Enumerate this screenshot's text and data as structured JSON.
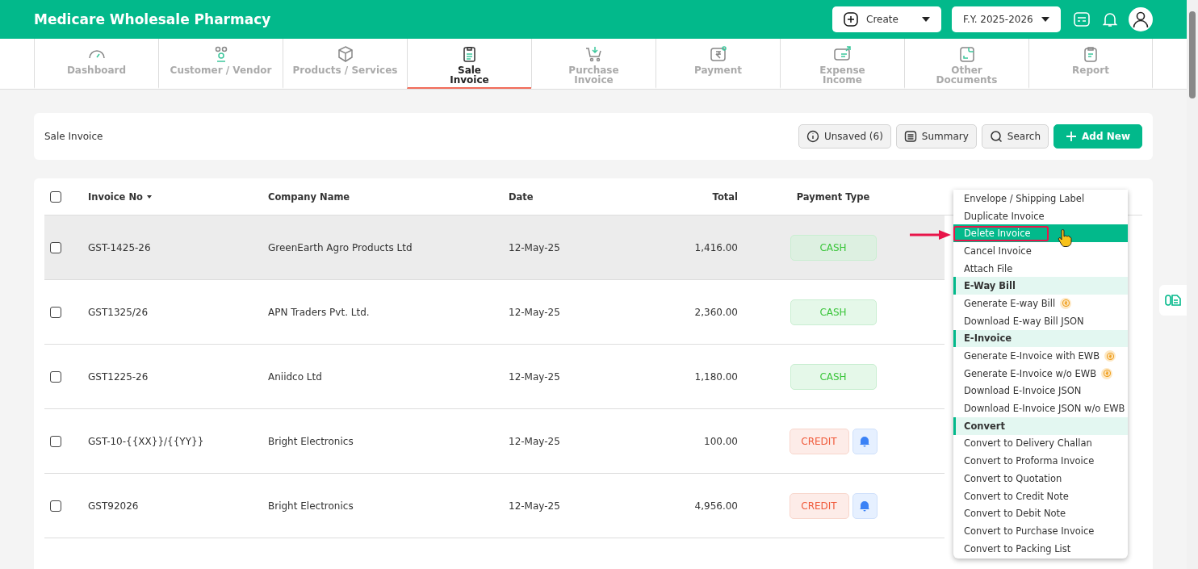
{
  "header": {
    "title": "Medicare Wholesale Pharmacy",
    "create_button": "Create",
    "year_select": "F.Y. 2025-2026"
  },
  "nav_tabs": [
    {
      "label": "Dashboard",
      "selected": false
    },
    {
      "label": "Customer / Vendor",
      "selected": false
    },
    {
      "label": "Products / Services",
      "selected": false
    },
    {
      "label": "Sale\nInvoice",
      "selected": true
    },
    {
      "label": "Purchase\nInvoice",
      "selected": false
    },
    {
      "label": "Payment",
      "selected": false
    },
    {
      "label": "Expense\nIncome",
      "selected": false
    },
    {
      "label": "Other\nDocuments",
      "selected": false
    },
    {
      "label": "Report",
      "selected": false
    }
  ],
  "toolbar": {
    "title": "Sale Invoice",
    "buttons": [
      {
        "label": "Unsaved (6)",
        "kind": "info"
      },
      {
        "label": "Summary",
        "kind": "list"
      },
      {
        "label": "Search",
        "kind": "search"
      },
      {
        "label": "Add New",
        "kind": "add"
      }
    ]
  },
  "table": {
    "select_all": {
      "checked": false
    },
    "columns": [
      "Invoice No",
      "Company Name",
      "Date",
      "Total",
      "Payment Type"
    ],
    "rows": [
      {
        "invoice_no": "GST-1425-26",
        "company": "GreenEarth Agro Products Ltd",
        "date": "12-May-25",
        "total": "1,416.00",
        "payment": "CASH",
        "kind": "cash",
        "checked": false,
        "highlighted": true
      },
      {
        "invoice_no": "GST1325/26",
        "company": "APN Traders Pvt. Ltd.",
        "date": "12-May-25",
        "total": "2,360.00",
        "payment": "CASH",
        "kind": "cash",
        "checked": false,
        "highlighted": false
      },
      {
        "invoice_no": "GST1225-26",
        "company": "Aniidco Ltd",
        "date": "12-May-25",
        "total": "1,180.00",
        "payment": "CASH",
        "kind": "cash",
        "checked": false,
        "highlighted": false
      },
      {
        "invoice_no": "GST-10-{{XX}}/{{YY}}",
        "company": "Bright Electronics",
        "date": "12-May-25",
        "total": "100.00",
        "payment": "CREDIT",
        "kind": "credit",
        "checked": false,
        "highlighted": false
      },
      {
        "invoice_no": "GST92026",
        "company": "Bright Electronics",
        "date": "12-May-25",
        "total": "4,956.00",
        "payment": "CREDIT",
        "kind": "credit",
        "checked": false,
        "highlighted": false
      }
    ]
  },
  "context_menu": [
    {
      "label": "Envelope / Shipping Label",
      "kind": "item",
      "selected": false
    },
    {
      "label": "Duplicate Invoice",
      "kind": "item",
      "selected": false
    },
    {
      "label": "Delete Invoice",
      "kind": "item",
      "selected": true
    },
    {
      "label": "Cancel Invoice",
      "kind": "item",
      "selected": false
    },
    {
      "label": "Attach File",
      "kind": "item",
      "selected": false
    },
    {
      "label": "E-Way Bill",
      "kind": "section"
    },
    {
      "label": "Generate E-way Bill",
      "kind": "premium",
      "selected": false
    },
    {
      "label": "Download E-way Bill JSON",
      "kind": "item",
      "selected": false
    },
    {
      "label": "E-Invoice",
      "kind": "section"
    },
    {
      "label": "Generate E-Invoice with EWB",
      "kind": "premium",
      "selected": false
    },
    {
      "label": "Generate E-Invoice w/o EWB",
      "kind": "premium",
      "selected": false
    },
    {
      "label": "Download E-Invoice JSON",
      "kind": "item",
      "selected": false
    },
    {
      "label": "Download E-Invoice JSON w/o EWB",
      "kind": "item",
      "selected": false
    },
    {
      "label": "Convert",
      "kind": "section"
    },
    {
      "label": "Convert to Delivery Challan",
      "kind": "item",
      "selected": false
    },
    {
      "label": "Convert to Proforma Invoice",
      "kind": "item",
      "selected": false
    },
    {
      "label": "Convert to Quotation",
      "kind": "item",
      "selected": false
    },
    {
      "label": "Convert to Credit Note",
      "kind": "item",
      "selected": false
    },
    {
      "label": "Convert to Debit Note",
      "kind": "item",
      "selected": false
    },
    {
      "label": "Convert to Purchase Invoice",
      "kind": "item",
      "selected": false
    },
    {
      "label": "Convert to Packing List",
      "kind": "item",
      "selected": false
    }
  ]
}
